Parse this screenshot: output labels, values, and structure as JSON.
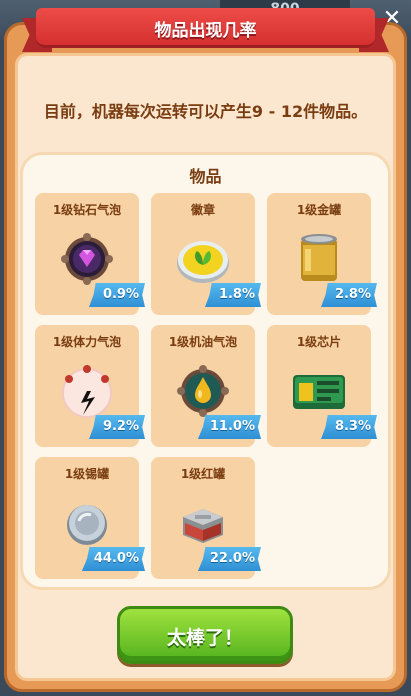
{
  "topbar": {
    "counter_value": "800"
  },
  "dialog": {
    "title": "物品出现几率",
    "info": "目前，机器每次运转可以产生9 - 12件物品。",
    "items_title": "物品",
    "items": [
      {
        "name": "1级钻石气泡",
        "rate": "0.9%",
        "icon": "diamond-bubble-icon"
      },
      {
        "name": "徽章",
        "rate": "1.8%",
        "icon": "badge-icon"
      },
      {
        "name": "1级金罐",
        "rate": "2.8%",
        "icon": "gold-can-icon"
      },
      {
        "name": "1级体力气泡",
        "rate": "9.2%",
        "icon": "energy-bubble-icon"
      },
      {
        "name": "1级机油气泡",
        "rate": "11.0%",
        "icon": "oil-bubble-icon"
      },
      {
        "name": "1级芯片",
        "rate": "8.3%",
        "icon": "chip-icon"
      },
      {
        "name": "1级锡罐",
        "rate": "44.0%",
        "icon": "tin-can-icon"
      },
      {
        "name": "1级红罐",
        "rate": "22.0%",
        "icon": "red-can-icon"
      }
    ],
    "confirm_label": "太棒了！",
    "close_glyph": "✕"
  },
  "colors": {
    "panel_orange": "#e79a55",
    "ribbon_red": "#d3302f",
    "tag_blue": "#2f8fd4",
    "button_green": "#53b21c",
    "text_brown": "#7a3d12"
  }
}
